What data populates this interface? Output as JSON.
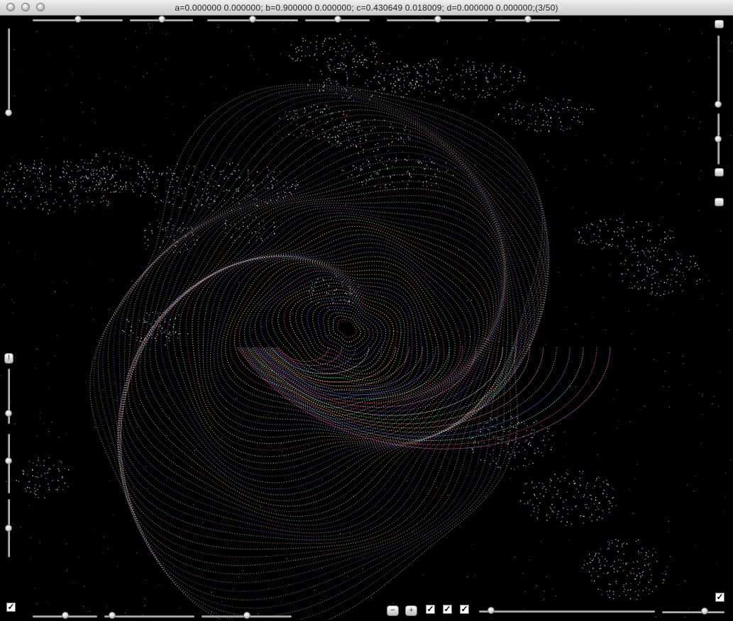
{
  "window": {
    "title": "a=0.000000 0.000000; b=0.900000 0.000000; c=0.430649 0.018009; d=0.000000 0.000000;(3/50)"
  },
  "buttons": {
    "minus_label": "−",
    "plus_label": "+",
    "exclaim_label": "!"
  },
  "checkboxes": {
    "mark": "✓",
    "bottom_left_checked": true,
    "bottom_center_1_checked": true,
    "bottom_center_2_checked": true,
    "bottom_center_3_checked": true,
    "bottom_right_checked": true
  },
  "sliders": {
    "top_1": 0.5,
    "top_2": 0.5,
    "top_3": 0.5,
    "top_4": 0.5,
    "top_5": 0.5,
    "top_6": 0.5,
    "left_1": 1.0,
    "left_2": 0.85,
    "left_3": 0.45,
    "left_4": 0.5,
    "right_1": 1.0,
    "right_2": 0.5,
    "bottom_1": 0.5,
    "bottom_2": 0.05,
    "bottom_3": 0.5,
    "bottom_4": 0.05,
    "bottom_5": 0.7
  },
  "colors": {
    "background": "#000000",
    "cloud_cyan": "#9fe6ff",
    "trail_palette": [
      "#ff6b6b",
      "#f0f0f0",
      "#7cff7c",
      "#ff7cf0",
      "#8080ff",
      "#ffd27c",
      "#c07cff",
      "#7cffff",
      "#ff9f6b",
      "#ffffff"
    ]
  }
}
